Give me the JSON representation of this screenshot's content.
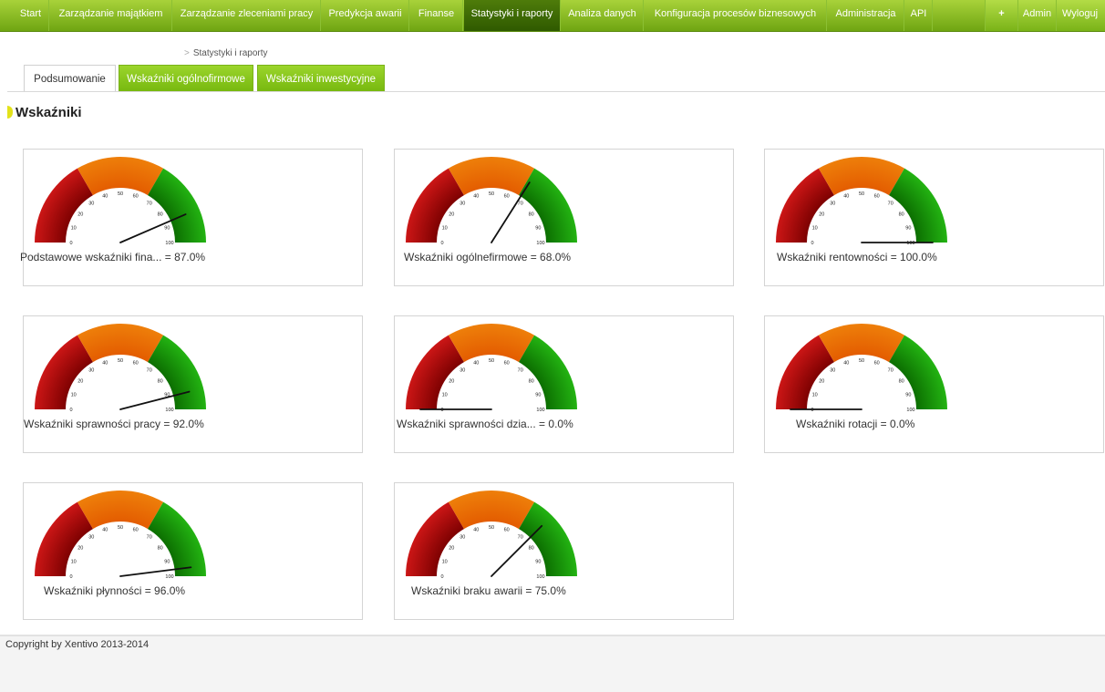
{
  "nav": {
    "items": [
      {
        "label": "Start"
      },
      {
        "label": "Zarządzanie majątkiem"
      },
      {
        "label": "Zarządzanie zleceniami pracy"
      },
      {
        "label": "Predykcja awarii"
      },
      {
        "label": "Finanse"
      },
      {
        "label": "Statystyki i raporty",
        "active": true
      },
      {
        "label": "Analiza danych"
      },
      {
        "label": "Konfiguracja procesów biznesowych"
      },
      {
        "label": "Administracja"
      },
      {
        "label": "API"
      }
    ],
    "plus_icon": "plus-icon",
    "user_label": "Admin",
    "logout_label": "Wyloguj"
  },
  "breadcrumb": {
    "separator": ">",
    "current": "Statystyki i raporty"
  },
  "tabs": [
    {
      "label": "Podsumowanie",
      "active": true
    },
    {
      "label": "Wskaźniki ogólnofirmowe"
    },
    {
      "label": "Wskaźniki inwestycyjne"
    }
  ],
  "section": {
    "title": "Wskaźniki"
  },
  "gauge_ticks": [
    "0",
    "10",
    "20",
    "30",
    "40",
    "50",
    "60",
    "70",
    "80",
    "90",
    "100"
  ],
  "gauge_colors": {
    "red": "#cc1616",
    "orange": "#ee7f0a",
    "green": "#23b312",
    "needle": "#111111"
  },
  "gauges": [
    {
      "caption": "Podstawowe wskaźniki fina... = 87.0%",
      "value": 87
    },
    {
      "caption": "Wskaźniki ogólnefirmowe = 68.0%",
      "value": 68
    },
    {
      "caption": "Wskaźniki rentowności = 100.0%",
      "value": 100
    },
    {
      "caption": "Wskaźniki sprawności pracy = 92.0%",
      "value": 92
    },
    {
      "caption": "Wskaźniki sprawności dzia... = 0.0%",
      "value": 0
    },
    {
      "caption": "Wskaźniki rotacji = 0.0%",
      "value": 0
    },
    {
      "caption": "Wskaźniki płynności = 96.0%",
      "value": 96
    },
    {
      "caption": "Wskaźniki braku awarii = 75.0%",
      "value": 75
    }
  ],
  "footer": {
    "copyright": "Copyright by Xentivo 2013-2014"
  }
}
